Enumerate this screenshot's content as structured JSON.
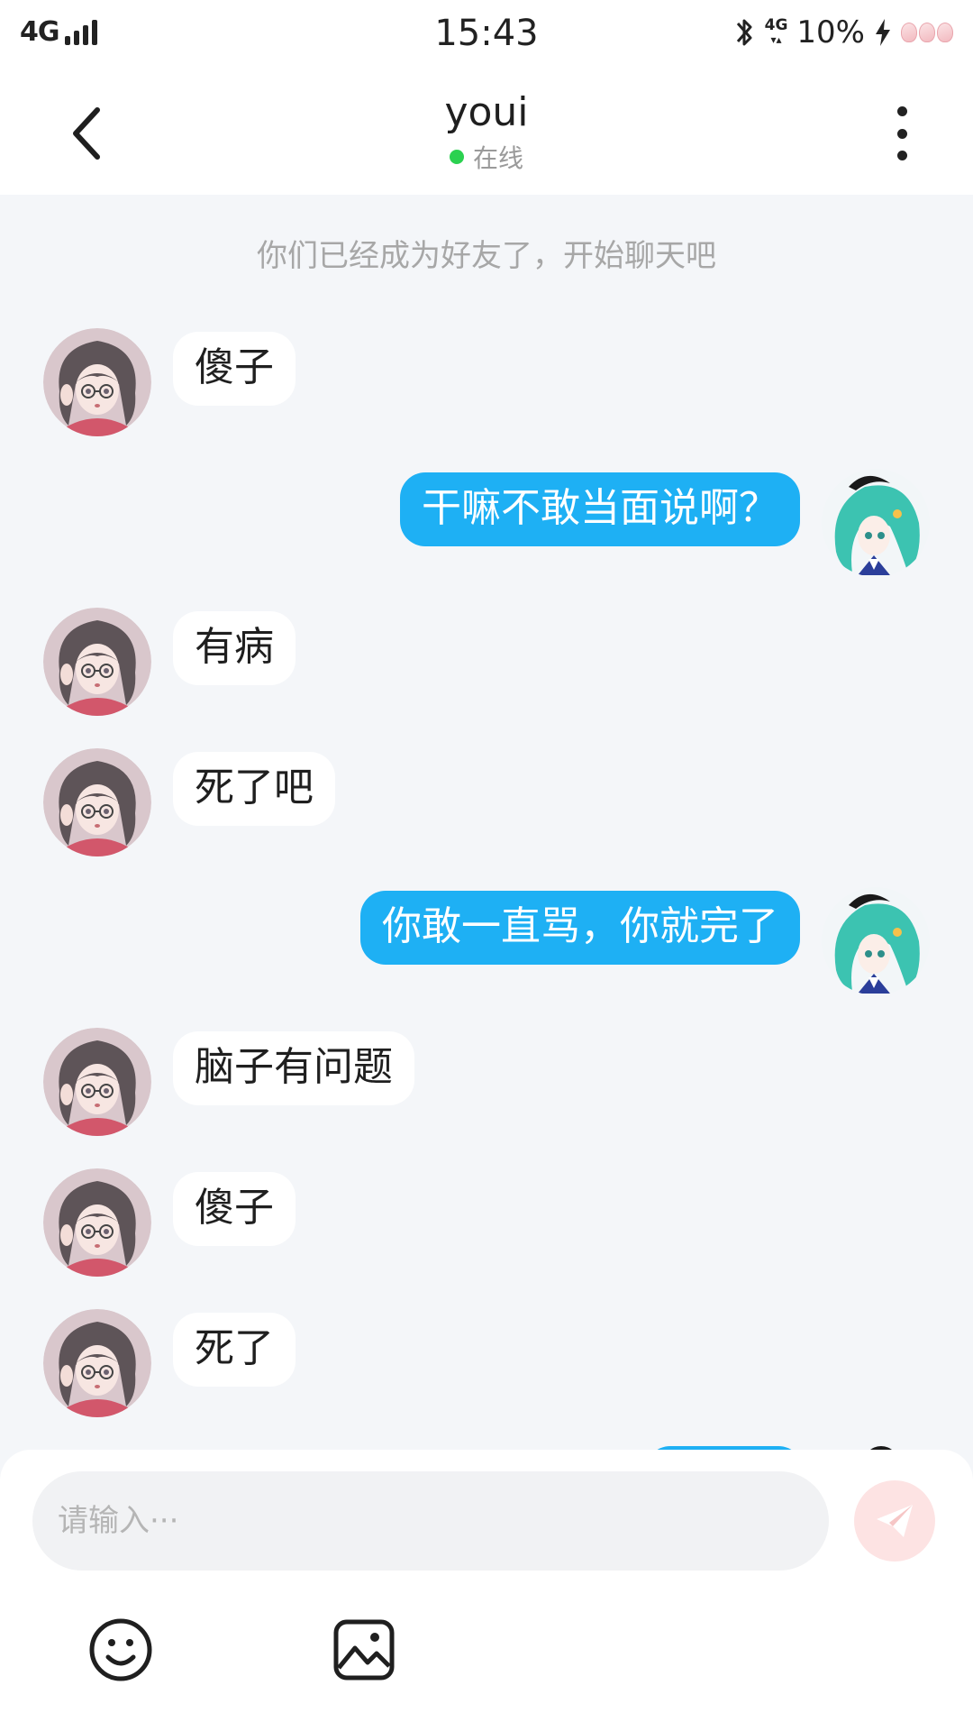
{
  "status_bar": {
    "network": "4G",
    "time": "15:43",
    "network_right": "4G",
    "battery": "10%"
  },
  "header": {
    "title": "youi",
    "status": "在线",
    "status_color": "#2bd150"
  },
  "chat": {
    "system_note": "你们已经成为好友了，开始聊天吧",
    "messages": [
      {
        "side": "left",
        "text": "傻子"
      },
      {
        "side": "right",
        "text": "干嘛不敢当面说啊？"
      },
      {
        "side": "left",
        "text": "有病"
      },
      {
        "side": "left",
        "text": "死了吧"
      },
      {
        "side": "right",
        "text": "你敢一直骂，你就完了"
      },
      {
        "side": "left",
        "text": "脑子有问题"
      },
      {
        "side": "left",
        "text": "傻子"
      },
      {
        "side": "left",
        "text": "死了"
      }
    ]
  },
  "input": {
    "placeholder": "请输入···"
  },
  "icons": {
    "back": "chevron-left-icon",
    "more": "more-vertical-icon",
    "send": "paper-plane-icon",
    "emoji": "smiley-icon",
    "image": "image-icon"
  },
  "colors": {
    "accent": "#1eb0f4",
    "send_button": "#fde3e3",
    "background": "#f4f6f9"
  }
}
